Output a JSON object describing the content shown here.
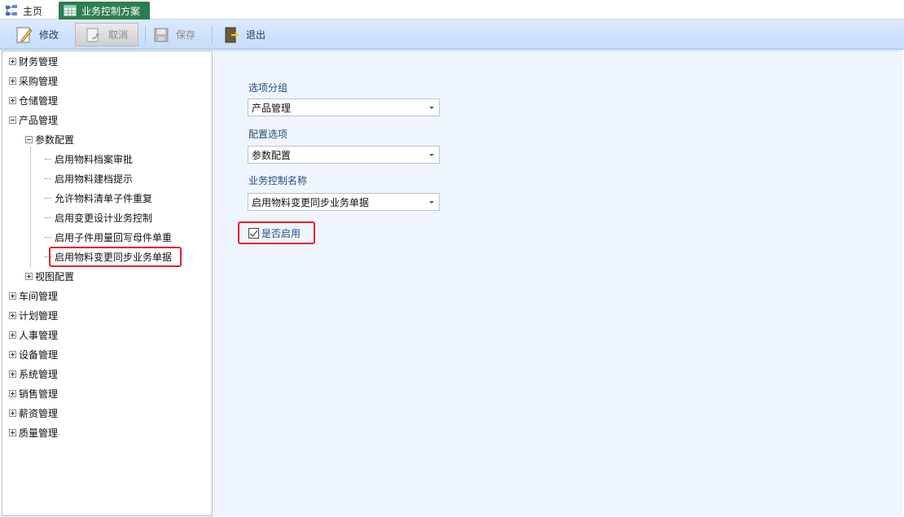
{
  "tabs": {
    "home_label": "主页",
    "active_label": "业务控制方案"
  },
  "toolbar": {
    "edit_label": "修改",
    "cancel_label": "取消",
    "save_label": "保存",
    "exit_label": "退出"
  },
  "tree": {
    "top": [
      {
        "label": "财务管理"
      },
      {
        "label": "采购管理"
      },
      {
        "label": "仓储管理"
      },
      {
        "label": "产品管理"
      }
    ],
    "product_children": {
      "param_config": "参数配置",
      "param_items": [
        "启用物料档案审批",
        "启用物料建档提示",
        "允许物料清单子件重复",
        "启用变更设计业务控制",
        "启用子件用量回写母件单重",
        "启用物料变更同步业务单据"
      ],
      "view_config": "视图配置"
    },
    "bottom": [
      {
        "label": "车间管理"
      },
      {
        "label": "计划管理"
      },
      {
        "label": "人事管理"
      },
      {
        "label": "设备管理"
      },
      {
        "label": "系统管理"
      },
      {
        "label": "销售管理"
      },
      {
        "label": "薪资管理"
      },
      {
        "label": "质量管理"
      }
    ]
  },
  "form": {
    "group_label": "选项分组",
    "group_value": "产品管理",
    "config_label": "配置选项",
    "config_value": "参数配置",
    "name_label": "业务控制名称",
    "name_value": "启用物料变更同步业务单据",
    "enabled_label": "是否启用",
    "enabled": true
  },
  "colors": {
    "active_tab": "#2e7d4f",
    "highlight": "#e3222b",
    "panel_bg": "#eef5fd"
  }
}
